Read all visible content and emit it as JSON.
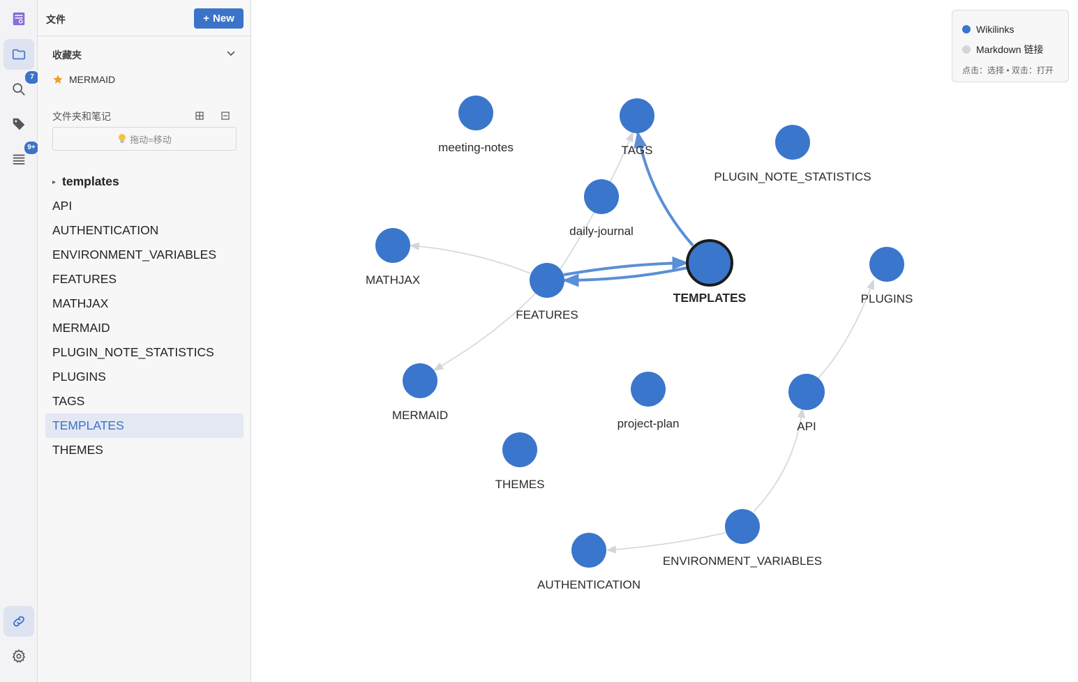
{
  "colors": {
    "accent": "#3b73c9",
    "node": "#3a76cc",
    "edge_wiki": "#5a8fd6",
    "edge_md": "#d4d5da"
  },
  "activity_bar": {
    "items": [
      {
        "icon": "app-logo-icon"
      },
      {
        "icon": "folder-icon",
        "active": true
      },
      {
        "icon": "search-icon",
        "badge": "7"
      },
      {
        "icon": "tag-icon"
      },
      {
        "icon": "list-icon",
        "badge": "9+"
      },
      {
        "icon": "link-icon",
        "active": true
      },
      {
        "icon": "settings-gear-icon"
      }
    ]
  },
  "sidebar": {
    "title": "文件",
    "new_button": "New",
    "favorites_label": "收藏夹",
    "favorites": [
      {
        "label": "MERMAID",
        "icon": "star-icon"
      }
    ],
    "tree_label": "文件夹和笔记",
    "hint": "拖动=移动",
    "folders": [
      {
        "label": "templates",
        "expanded": false
      }
    ],
    "notes": [
      "API",
      "AUTHENTICATION",
      "ENVIRONMENT_VARIABLES",
      "FEATURES",
      "MATHJAX",
      "MERMAID",
      "PLUGIN_NOTE_STATISTICS",
      "PLUGINS",
      "TAGS",
      "TEMPLATES",
      "THEMES"
    ],
    "selected_note": "TEMPLATES"
  },
  "graph": {
    "current_node": "TEMPLATES",
    "nodes": [
      "meeting-notes",
      "TAGS",
      "PLUGIN_NOTE_STATISTICS",
      "daily-journal",
      "MATHJAX",
      "FEATURES",
      "TEMPLATES",
      "PLUGINS",
      "MERMAID",
      "project-plan",
      "API",
      "THEMES",
      "ENVIRONMENT_VARIABLES",
      "AUTHENTICATION"
    ],
    "links": [
      {
        "from": "TEMPLATES",
        "to": "TAGS",
        "type": "wikilink"
      },
      {
        "from": "TEMPLATES",
        "to": "FEATURES",
        "type": "wikilink"
      },
      {
        "from": "FEATURES",
        "to": "TEMPLATES",
        "type": "wikilink"
      },
      {
        "from": "FEATURES",
        "to": "TAGS",
        "type": "markdown"
      },
      {
        "from": "FEATURES",
        "to": "MATHJAX",
        "type": "markdown"
      },
      {
        "from": "FEATURES",
        "to": "MERMAID",
        "type": "markdown"
      },
      {
        "from": "API",
        "to": "PLUGINS",
        "type": "markdown"
      },
      {
        "from": "ENVIRONMENT_VARIABLES",
        "to": "API",
        "type": "markdown"
      },
      {
        "from": "ENVIRONMENT_VARIABLES",
        "to": "AUTHENTICATION",
        "type": "markdown"
      }
    ]
  },
  "legend": {
    "wikilinks": "Wikilinks",
    "markdown": "Markdown 链接",
    "hint": "点击：选择 • 双击：打开"
  }
}
